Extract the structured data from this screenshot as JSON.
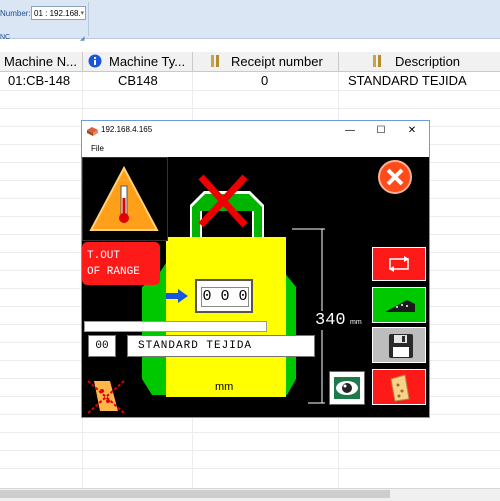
{
  "toolbar": {
    "label": "Number:",
    "combo_value": "01 : 192.168.",
    "group_label": "NC"
  },
  "grid": {
    "columns": [
      "Machine N...",
      "Machine Ty...",
      "Receipt number",
      "Description"
    ],
    "rows": [
      {
        "machine_number": "01:CB-148",
        "machine_type": "CB148",
        "receipt_number": "0",
        "description": "STANDARD TEJIDA"
      }
    ]
  },
  "dialog": {
    "title": "192.168.4.165",
    "menu": {
      "file": "File"
    },
    "controls": {
      "minimize": "—",
      "maximize": "☐",
      "close": "✕"
    },
    "alarm_text_line1": "T.OUT",
    "alarm_text_line2": "OF RANGE",
    "counter_value": "0 0 0",
    "dimension_value": "340",
    "dimension_unit": "mm",
    "bottom_unit": "mm",
    "program_number": "00",
    "program_name": "STANDARD TEJIDA"
  },
  "colors": {
    "canvas_bg": "#000000",
    "alarm_red": "#ff1a1a",
    "yellow": "#ffff00",
    "green": "#00c800",
    "accent_blue": "#1a56db"
  },
  "icons": {
    "alarm": "thermometer-warning-icon",
    "close_red": "close-circle-icon",
    "cross_x": "red-x-icon",
    "swap": "swap-arrows-icon",
    "needles": "needle-bed-icon",
    "save": "floppy-disk-icon",
    "eye": "eye-icon",
    "fabric": "fabric-roll-icon"
  }
}
